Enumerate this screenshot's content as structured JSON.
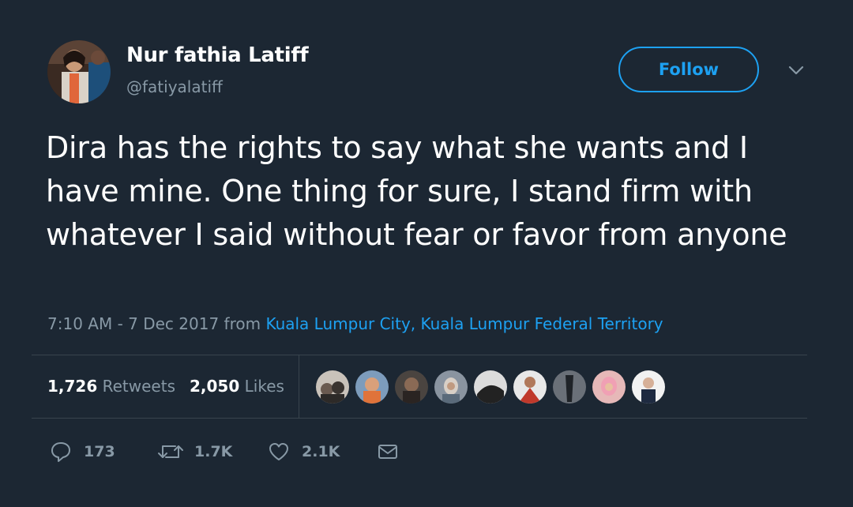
{
  "author": {
    "name": "Nur fathia Latiff",
    "handle": "@fatiyalatiff"
  },
  "follow_label": "Follow",
  "tweet": {
    "text": "Dira has the rights to say what she wants and I have mine. One thing for sure, I stand firm with whatever I said without fear or favor from anyone",
    "time": "7:10 AM - 7 Dec 2017",
    "from": "from",
    "location": "Kuala Lumpur City, Kuala Lumpur Federal Territory"
  },
  "stats": {
    "retweets_count": "1,726",
    "retweets_label": "Retweets",
    "likes_count": "2,050",
    "likes_label": "Likes"
  },
  "likers": [
    "avatar-1",
    "avatar-2",
    "avatar-3",
    "avatar-4",
    "avatar-5",
    "avatar-6",
    "avatar-7",
    "avatar-8",
    "avatar-9"
  ],
  "actions": {
    "reply_count": "173",
    "retweet_count": "1.7K",
    "like_count": "2.1K"
  },
  "colors": {
    "background": "#1c2733",
    "accent": "#1da1f2",
    "muted": "#8899a6",
    "divider": "#38444d"
  }
}
